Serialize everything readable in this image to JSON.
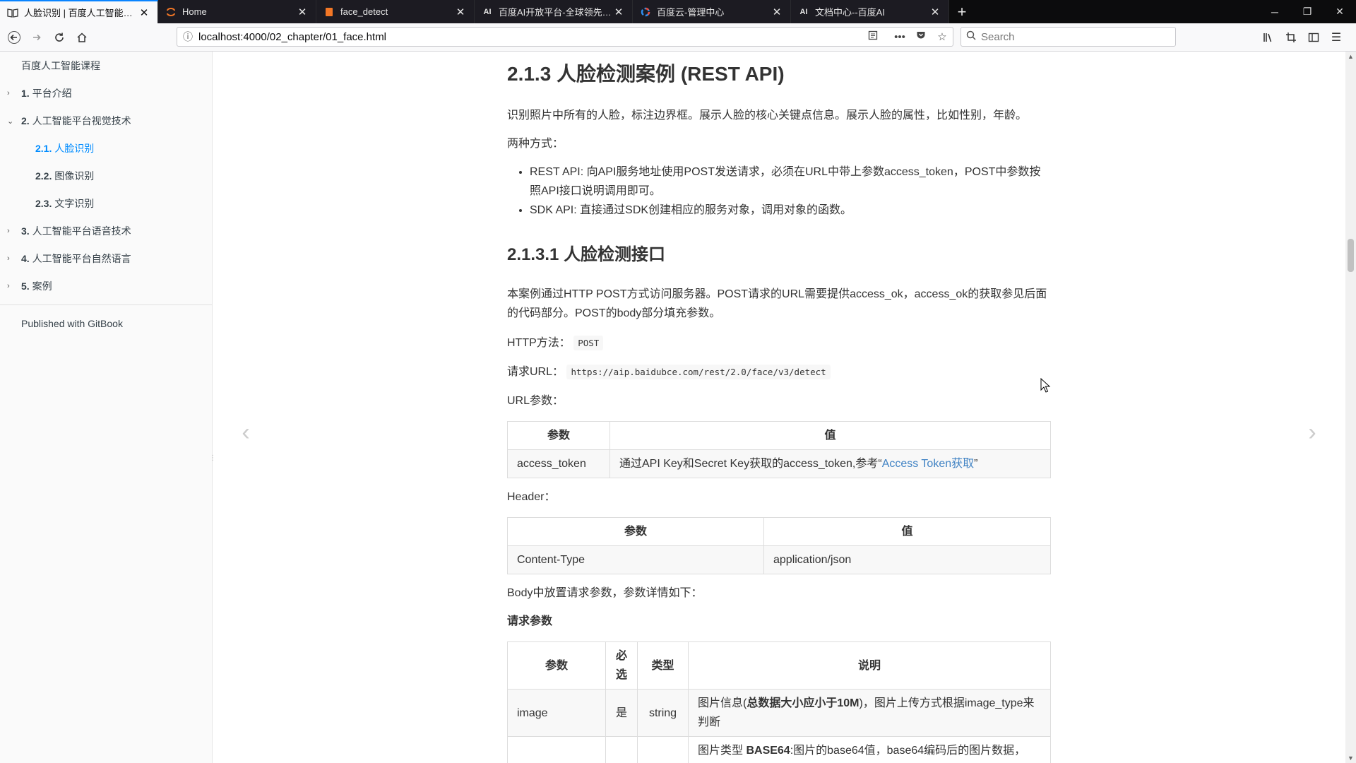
{
  "browser": {
    "tabs": [
      {
        "title": "人脸识别 | 百度人工智能课程",
        "icon": "book-icon",
        "active": true
      },
      {
        "title": "Home",
        "icon": "jupyter-icon",
        "active": false
      },
      {
        "title": "face_detect",
        "icon": "notebook-icon",
        "active": false
      },
      {
        "title": "百度AI开放平台-全球领先的人",
        "icon": "ai-icon",
        "icon_text": "AI",
        "active": false
      },
      {
        "title": "百度云-管理中心",
        "icon": "baidu-cloud-icon",
        "active": false
      },
      {
        "title": "文档中心--百度AI",
        "icon": "ai-icon",
        "icon_text": "AI",
        "active": false
      }
    ],
    "url": "localhost:4000/02_chapter/01_face.html",
    "search_placeholder": "Search"
  },
  "sidebar": {
    "title": "百度人工智能课程",
    "items": [
      {
        "num": "1.",
        "label": "平台介绍",
        "expanded": false
      },
      {
        "num": "2.",
        "label": "人工智能平台视觉技术",
        "expanded": true
      },
      {
        "num": "2.1.",
        "label": "人脸识别",
        "active": true
      },
      {
        "num": "2.2.",
        "label": "图像识别"
      },
      {
        "num": "2.3.",
        "label": "文字识别"
      },
      {
        "num": "3.",
        "label": "人工智能平台语音技术",
        "expanded": false
      },
      {
        "num": "4.",
        "label": "人工智能平台自然语言",
        "expanded": false
      },
      {
        "num": "5.",
        "label": "案例",
        "expanded": false
      }
    ],
    "footer": "Published with GitBook"
  },
  "content": {
    "h2": "2.1.3 人脸检测案例 (REST API)",
    "intro": "识别照片中所有的人脸，标注边界框。展示人脸的核心关键点信息。展示人脸的属性，比如性别，年龄。",
    "two_ways": "两种方式：",
    "bullets": [
      "REST API: 向API服务地址使用POST发送请求，必须在URL中带上参数access_token，POST中参数按照API接口说明调用即可。",
      "SDK API: 直接通过SDK创建相应的服务对象，调用对象的函数。"
    ],
    "h3": "2.1.3.1 人脸检测接口",
    "desc": "本案例通过HTTP POST方式访问服务器。POST请求的URL需要提供access_ok，access_ok的获取参见后面的代码部分。POST的body部分填充参数。",
    "http_method_label": "HTTP方法：",
    "http_method": "POST",
    "request_url_label": "请求URL：",
    "request_url": "https://aip.baidubce.com/rest/2.0/face/v3/detect",
    "url_params_label": "URL参数：",
    "url_table": {
      "headers": [
        "参数",
        "值"
      ],
      "row_key": "access_token",
      "row_text": "通过API Key和Secret Key获取的access_token,参考“",
      "row_link": "Access Token获取",
      "row_tail": "”"
    },
    "header_label": "Header：",
    "header_table": {
      "headers": [
        "参数",
        "值"
      ],
      "row": [
        "Content-Type",
        "application/json"
      ]
    },
    "body_label": "Body中放置请求参数，参数详情如下：",
    "req_params_title": "请求参数",
    "req_table": {
      "headers": [
        "参数",
        "必选",
        "类型",
        "说明"
      ],
      "row1": {
        "param": "image",
        "required": "是",
        "type": "string",
        "desc_pre": "图片信息(",
        "desc_bold": "总数据大小应小于10M",
        "desc_post": ")，图片上传方式根据image_type来判断"
      },
      "row2": {
        "desc_pre": "图片类型 ",
        "desc_bold": "BASE64",
        "desc_post": ":图片的base64值，base64编码后的图片数据，"
      }
    }
  },
  "colors": {
    "accent": "#008cff",
    "link": "#4183c4",
    "tab_highlight": "#0a84ff"
  }
}
